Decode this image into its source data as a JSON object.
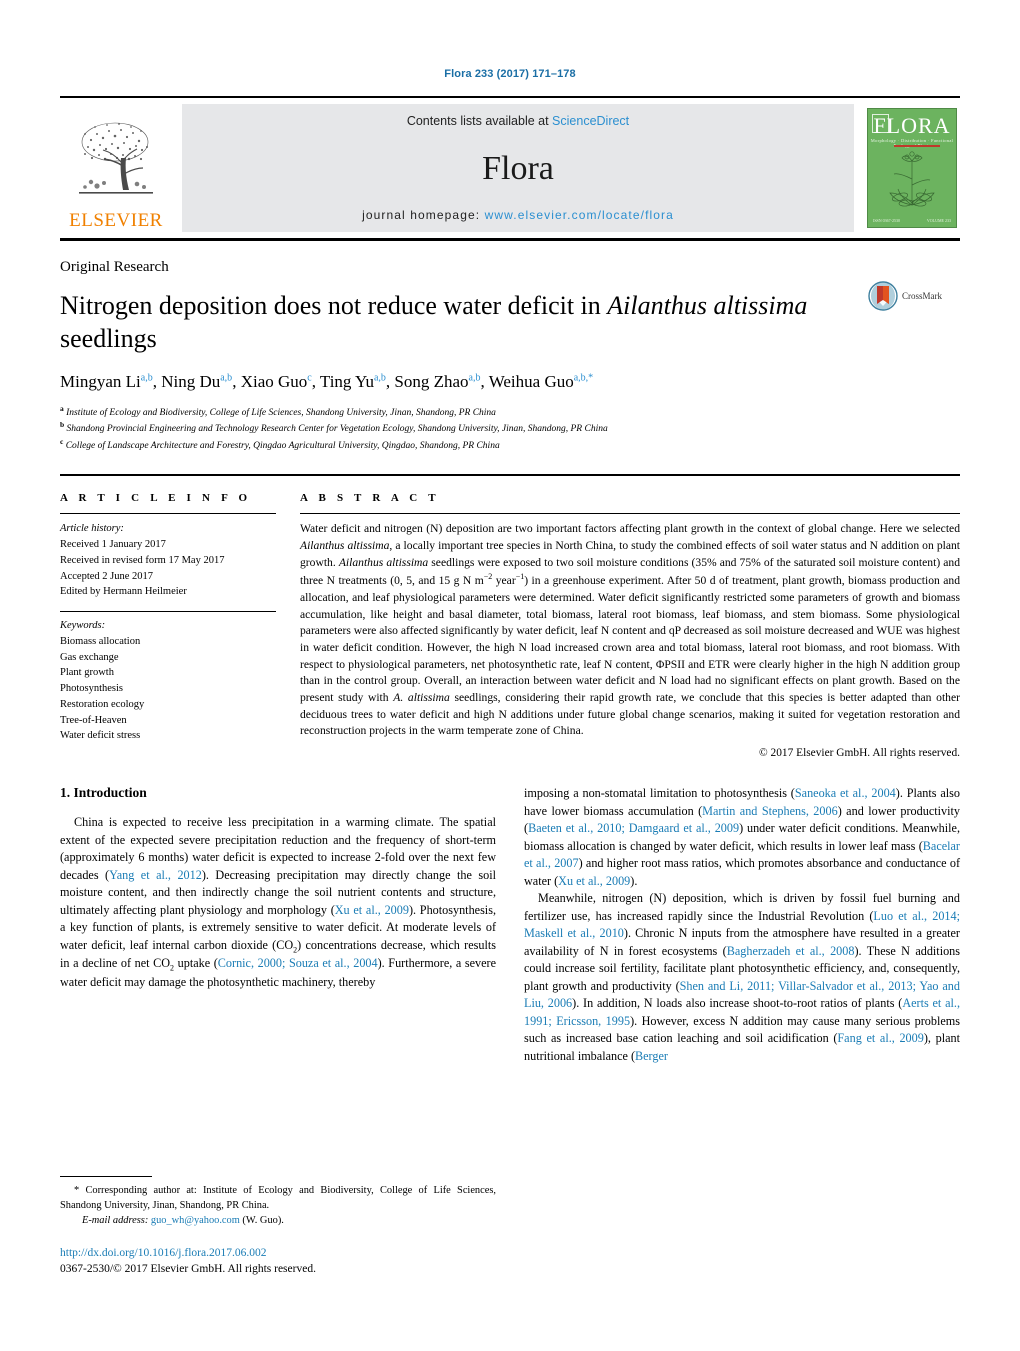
{
  "running_head": "Flora 233 (2017) 171–178",
  "masthead": {
    "publisher_name": "ELSEVIER",
    "contents_line_prefix": "Contents lists available at ",
    "contents_link": "ScienceDirect",
    "journal_name": "Flora",
    "homepage_prefix": "journal homepage: ",
    "homepage_link": "www.elsevier.com/locate/flora",
    "cover_title": "FLORA",
    "cover_subtitle": "Morphology · Distribution · Functional Ecology of Plants",
    "cover_footer_left": "ISSN 0367-2530",
    "cover_footer_right": "VOLUME 233"
  },
  "article": {
    "kicker": "Original Research",
    "title_part1": "Nitrogen deposition does not reduce water deficit in ",
    "title_italic1": "Ailanthus altissima",
    "title_part2": " seedlings",
    "crossmark_label": "CrossMark",
    "authors": [
      {
        "name": "Mingyan Li",
        "sup": "a,b"
      },
      {
        "name": "Ning Du",
        "sup": "a,b"
      },
      {
        "name": "Xiao Guo",
        "sup": "c"
      },
      {
        "name": "Ting Yu",
        "sup": "a,b"
      },
      {
        "name": "Song Zhao",
        "sup": "a,b"
      },
      {
        "name": "Weihua Guo",
        "sup": "a,b,*"
      }
    ],
    "affiliations": [
      {
        "mark": "a",
        "text": "Institute of Ecology and Biodiversity, College of Life Sciences, Shandong University, Jinan, Shandong, PR China"
      },
      {
        "mark": "b",
        "text": "Shandong Provincial Engineering and Technology Research Center for Vegetation Ecology, Shandong University, Jinan, Shandong, PR China"
      },
      {
        "mark": "c",
        "text": "College of Landscape Architecture and Forestry, Qingdao Agricultural University, Qingdao, Shandong, PR China"
      }
    ]
  },
  "article_info": {
    "heading": "A R T I C L E   I N F O",
    "history_label": "Article history:",
    "history": [
      "Received 1 January 2017",
      "Received in revised form 17 May 2017",
      "Accepted 2 June 2017",
      "Edited by Hermann Heilmeier"
    ],
    "keywords_label": "Keywords:",
    "keywords": [
      "Biomass allocation",
      "Gas exchange",
      "Plant growth",
      "Photosynthesis",
      "Restoration ecology",
      "Tree-of-Heaven",
      "Water deficit stress"
    ]
  },
  "abstract": {
    "heading": "A B S T R A C T",
    "paragraph_segments": [
      {
        "t": "Water deficit and nitrogen (N) deposition are two important factors affecting plant growth in the context of global change. Here we selected ",
        "i": false
      },
      {
        "t": "Ailanthus altissima",
        "i": true
      },
      {
        "t": ", a locally important tree species in North China, to study the combined effects of soil water status and N addition on plant growth. ",
        "i": false
      },
      {
        "t": "Ailanthus altissima",
        "i": true
      },
      {
        "t": " seedlings were exposed to two soil moisture conditions (35% and 75% of the saturated soil moisture content) and three N treatments (0, 5, and 15 g N m",
        "i": false
      },
      {
        "t": "SUP:−2",
        "i": false
      },
      {
        "t": " year",
        "i": false
      },
      {
        "t": "SUP:−1",
        "i": false
      },
      {
        "t": ") in a greenhouse experiment. After 50 d of treatment, plant growth, biomass production and allocation, and leaf physiological parameters were determined. Water deficit significantly restricted some parameters of growth and biomass accumulation, like height and basal diameter, total biomass, lateral root biomass, leaf biomass, and stem biomass. Some physiological parameters were also affected significantly by water deficit, leaf N content and qP decreased as soil moisture decreased and WUE was highest in water deficit condition. However, the high N load increased crown area and total biomass, lateral root biomass, and root biomass. With respect to physiological parameters, net photosynthetic rate, leaf N content, ΦPSII and ETR were clearly higher in the high N addition group than in the control group. Overall, an interaction between water deficit and N load had no significant effects on plant growth. Based on the present study with ",
        "i": false
      },
      {
        "t": "A. altissima",
        "i": true
      },
      {
        "t": " seedlings, considering their rapid growth rate, we conclude that this species is better adapted than other deciduous trees to water deficit and high N additions under future global change scenarios, making it suited for vegetation restoration and reconstruction projects in the warm temperate zone of China.",
        "i": false
      }
    ],
    "copyright": "© 2017 Elsevier GmbH. All rights reserved."
  },
  "introduction": {
    "heading": "1.  Introduction",
    "left_paragraph_segments": [
      {
        "t": "China is expected to receive less precipitation in a warming climate. The spatial extent of the expected severe precipitation reduction and the frequency of short-term (approximately 6 months) water deficit is expected to increase 2-fold over the next few decades (",
        "r": false
      },
      {
        "t": "Yang et al., 2012",
        "r": true
      },
      {
        "t": "). Decreasing precipitation may directly change the soil moisture content, and then indirectly change the soil nutrient contents and structure, ultimately affecting plant physiology and morphology (",
        "r": false
      },
      {
        "t": "Xu et al., 2009",
        "r": true
      },
      {
        "t": "). Photosynthesis, a key function of plants, is extremely sensitive to water deficit. At moderate levels of water deficit, leaf internal carbon dioxide (CO",
        "r": false
      },
      {
        "t": "SUB:2",
        "r": false
      },
      {
        "t": ") concentrations decrease, which results in a decline of net CO",
        "r": false
      },
      {
        "t": "SUB:2",
        "r": false
      },
      {
        "t": " uptake (",
        "r": false
      },
      {
        "t": "Cornic, 2000; Souza et al., 2004",
        "r": true
      },
      {
        "t": "). Furthermore, a severe water deficit may damage the photosynthetic machinery, thereby",
        "r": false
      }
    ],
    "right_paragraph1_segments": [
      {
        "t": "imposing a non-stomatal limitation to photosynthesis (",
        "r": false
      },
      {
        "t": "Saneoka et al., 2004",
        "r": true
      },
      {
        "t": "). Plants also have lower biomass accumulation (",
        "r": false
      },
      {
        "t": "Martin and Stephens, 2006",
        "r": true
      },
      {
        "t": ") and lower productivity (",
        "r": false
      },
      {
        "t": "Baeten et al., 2010; Damgaard et al., 2009",
        "r": true
      },
      {
        "t": ") under water deficit conditions. Meanwhile, biomass allocation is changed by water deficit, which results in lower leaf mass (",
        "r": false
      },
      {
        "t": "Bacelar et al., 2007",
        "r": true
      },
      {
        "t": ") and higher root mass ratios, which promotes absorbance and conductance of water (",
        "r": false
      },
      {
        "t": "Xu et al., 2009",
        "r": true
      },
      {
        "t": ").",
        "r": false
      }
    ],
    "right_paragraph2_segments": [
      {
        "t": "Meanwhile, nitrogen (N) deposition, which is driven by fossil fuel burning and fertilizer use, has increased rapidly since the Industrial Revolution (",
        "r": false
      },
      {
        "t": "Luo et al., 2014; Maskell et al., 2010",
        "r": true
      },
      {
        "t": "). Chronic N inputs from the atmosphere have resulted in a greater availability of N in forest ecosystems (",
        "r": false
      },
      {
        "t": "Bagherzadeh et al., 2008",
        "r": true
      },
      {
        "t": "). These N additions could increase soil fertility, facilitate plant photosynthetic efficiency, and, consequently, plant growth and productivity (",
        "r": false
      },
      {
        "t": "Shen and Li, 2011; Villar-Salvador et al., 2013; Yao and Liu, 2006",
        "r": true
      },
      {
        "t": "). In addition, N loads also increase shoot-to-root ratios of plants (",
        "r": false
      },
      {
        "t": "Aerts et al., 1991; Ericsson, 1995",
        "r": true
      },
      {
        "t": "). However, excess N addition may cause many serious problems such as increased base cation leaching and soil acidification (",
        "r": false
      },
      {
        "t": "Fang et al., 2009",
        "r": true
      },
      {
        "t": "), plant nutritional imbalance (",
        "r": false
      },
      {
        "t": "Berger",
        "r": true
      }
    ]
  },
  "footnote": {
    "star": "*",
    "corresponding_text": " Corresponding author at: Institute of Ecology and Biodiversity, College of Life Sciences, Shandong University, Jinan, Shandong, PR China.",
    "email_label": "E-mail address:",
    "email": "guo_wh@yahoo.com",
    "email_suffix": " (W. Guo)."
  },
  "footer": {
    "doi": "http://dx.doi.org/10.1016/j.flora.2017.06.002",
    "issn_line": "0367-2530/© 2017 Elsevier GmbH. All rights reserved."
  },
  "colors": {
    "link_blue": "#1a7cb5",
    "sd_blue": "#2b8fd0",
    "elsevier_orange": "#f08000",
    "cover_green": "#6cb35f"
  }
}
